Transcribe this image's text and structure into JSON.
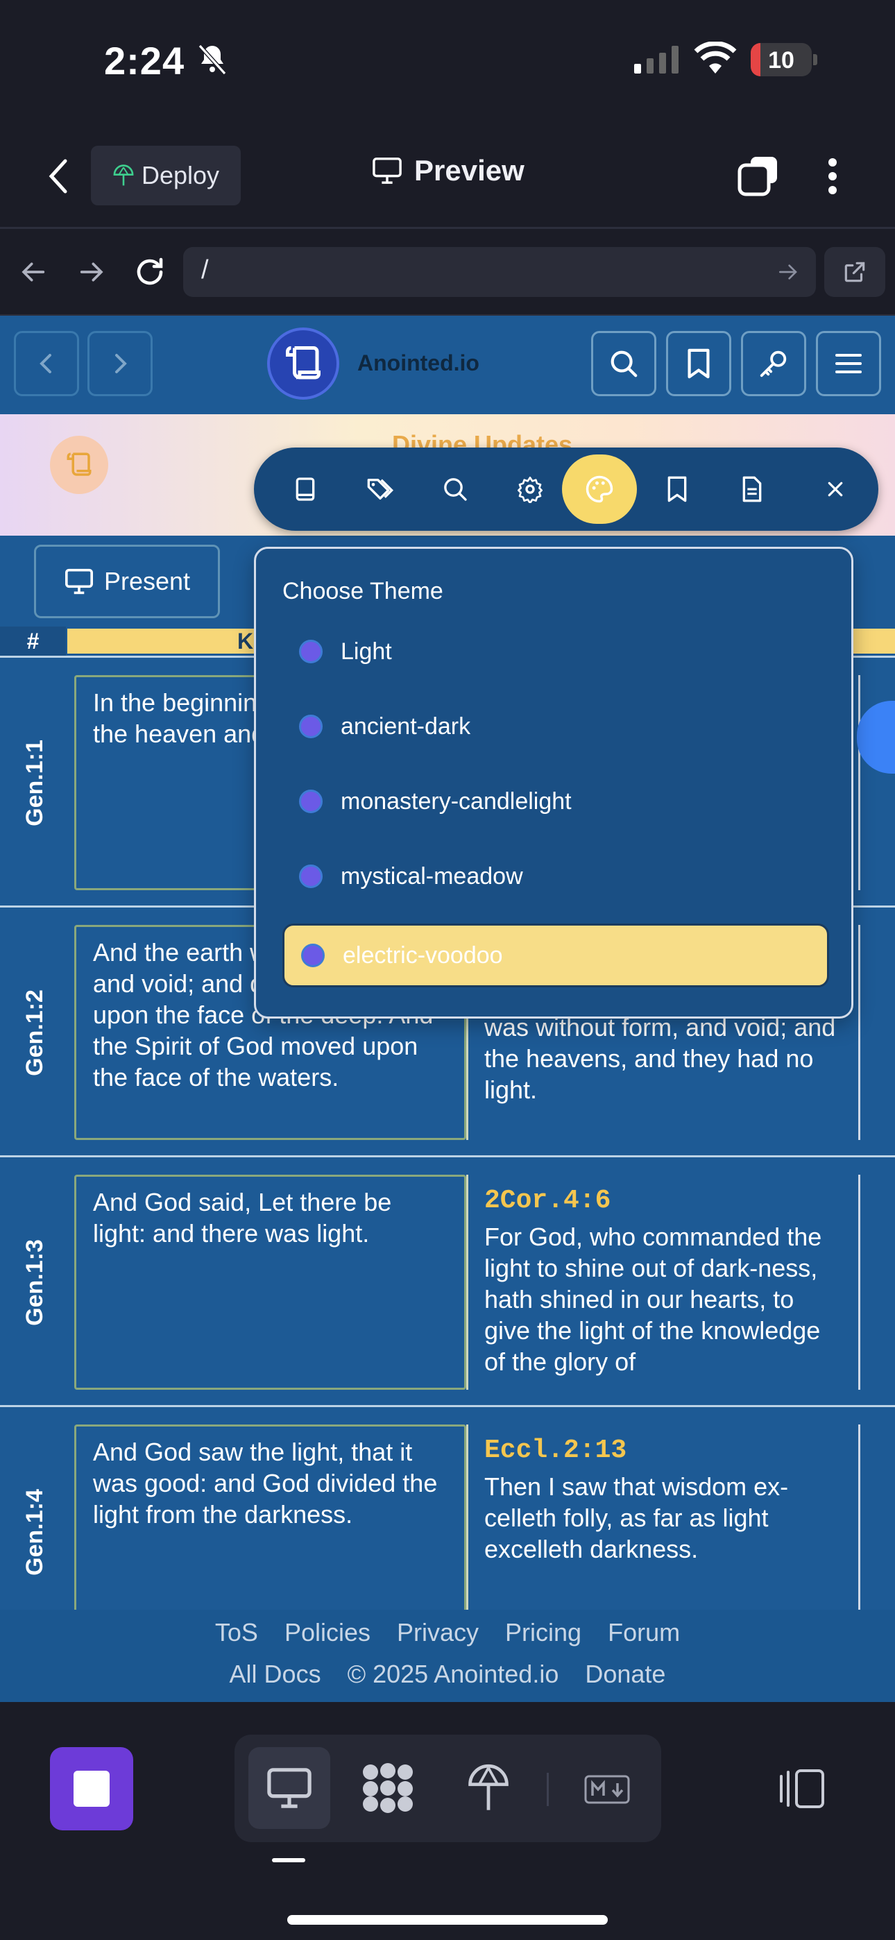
{
  "status_bar": {
    "time": "2:24",
    "battery": "10"
  },
  "app_header": {
    "deploy_label": "Deploy",
    "preview_label": "Preview"
  },
  "url_bar": {
    "url": "/"
  },
  "site": {
    "brand": "Anointed.io",
    "banner_title": "Divine Updates",
    "present_label": "Present",
    "table_header": {
      "hash": "#",
      "col": "K"
    }
  },
  "theme_menu": {
    "title": "Choose Theme",
    "options": [
      "Light",
      "ancient-dark",
      "monastery-candlelight",
      "mystical-meadow",
      "electric-voodoo"
    ],
    "selected": "electric-voodoo"
  },
  "rows": [
    {
      "ref": "Gen.1:1",
      "verse": "In the beginning God created the heaven and the earth.",
      "xref": "",
      "xref_text": ""
    },
    {
      "ref": "Gen.1:2",
      "verse": "And the earth was without form, and void; and darkness was upon the face of the deep. And the Spirit of God moved upon the face of the waters.",
      "xref": "",
      "xref_text": "was without form, and void; and the heavens, and they had no light."
    },
    {
      "ref": "Gen.1:3",
      "verse": "And God said, Let there be light: and there was light.",
      "xref": "2Cor.4:6",
      "xref_text": "For God, who commanded the light to shine out of dark-ness, hath shined in our hearts, to give the light of the knowledge of the glory of"
    },
    {
      "ref": "Gen.1:4",
      "verse": "And God saw the light, that it was good: and God divided the light from the darkness.",
      "xref": "Eccl.2:13",
      "xref_text": "Then I saw that wisdom ex-celleth folly, as far as light excelleth darkness."
    }
  ],
  "footer": {
    "row1": [
      "ToS",
      "Policies",
      "Privacy",
      "Pricing",
      "Forum"
    ],
    "row2": [
      "All Docs",
      "© 2025 Anointed.io",
      "Donate"
    ]
  },
  "colors": {
    "site_bg": "#1d5a95",
    "accent": "#f7d96b",
    "purple": "#6d3bd8"
  }
}
